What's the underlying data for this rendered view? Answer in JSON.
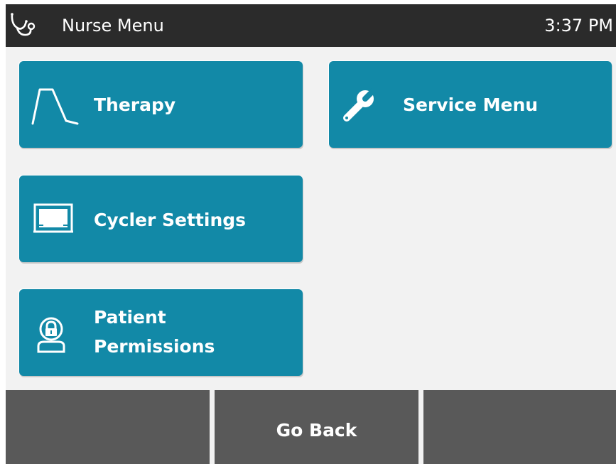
{
  "header": {
    "icon": "stethoscope-icon",
    "title": "Nurse Menu",
    "time": "3:37 PM"
  },
  "tiles": {
    "therapy": {
      "icon": "therapy-curve-icon",
      "label": "Therapy"
    },
    "service": {
      "icon": "wrench-icon",
      "label": "Service Menu"
    },
    "cycler": {
      "icon": "cycler-device-icon",
      "label": "Cycler Settings"
    },
    "patient": {
      "icon": "patient-lock-icon",
      "label_line1": "Patient",
      "label_line2": "Permissions"
    }
  },
  "footer": {
    "left_label": "",
    "middle_label": "Go Back",
    "right_label": ""
  },
  "colors": {
    "header_bg": "#2b2b2b",
    "tile_bg": "#1289a7",
    "footer_button_bg": "#595959",
    "screen_bg": "#f2f2f2"
  }
}
